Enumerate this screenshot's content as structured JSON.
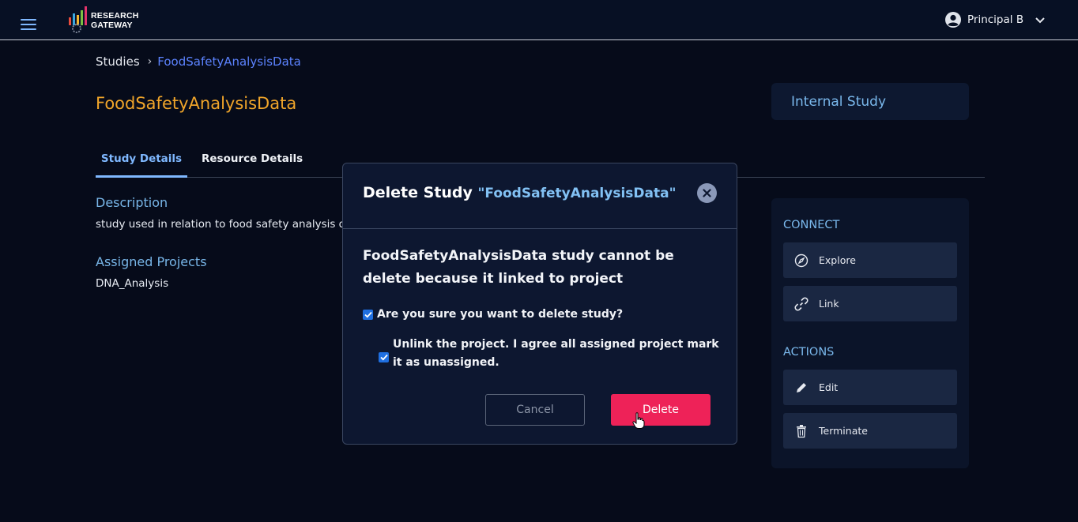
{
  "app": {
    "logo_line1": "RESEARCH",
    "logo_line2": "GATEWAY",
    "user_name": "Principal B"
  },
  "breadcrumb": {
    "root": "Studies",
    "current": "FoodSafetyAnalysisData"
  },
  "study": {
    "title": "FoodSafetyAnalysisData",
    "type": "Internal Study"
  },
  "tabs": [
    {
      "label": "Study Details",
      "active": true
    },
    {
      "label": "Resource Details",
      "active": false
    }
  ],
  "details": {
    "description_label": "Description",
    "description_value": "study used in relation to food safety analysis data",
    "projects_label": "Assigned Projects",
    "projects_value": "DNA_Analysis"
  },
  "panel": {
    "connect_heading": "CONNECT",
    "connect_items": [
      {
        "label": "Explore",
        "icon": "compass-icon"
      },
      {
        "label": "Link",
        "icon": "link-icon"
      }
    ],
    "actions_heading": "ACTIONS",
    "action_items": [
      {
        "label": "Edit",
        "icon": "pencil-icon"
      },
      {
        "label": "Terminate",
        "icon": "trash-icon"
      }
    ]
  },
  "modal": {
    "title_prefix": "Delete Study",
    "title_name": "\"FoodSafetyAnalysisData\"",
    "message": "FoodSafetyAnalysisData study cannot be delete because it linked to project",
    "confirm_label": "Are you sure you want to delete study?",
    "confirm_checked": true,
    "unlink_label": "Unlink the project. I agree all assigned project mark it as unassigned.",
    "unlink_checked": true,
    "cancel_label": "Cancel",
    "delete_label": "Delete"
  },
  "colors": {
    "background": "#060b1a",
    "title_accent": "#f0a52a",
    "link_blue": "#5c83ff",
    "label_blue": "#78b6e8",
    "delete_red": "#ee2258",
    "checkbox_blue": "#1f6fe0"
  }
}
